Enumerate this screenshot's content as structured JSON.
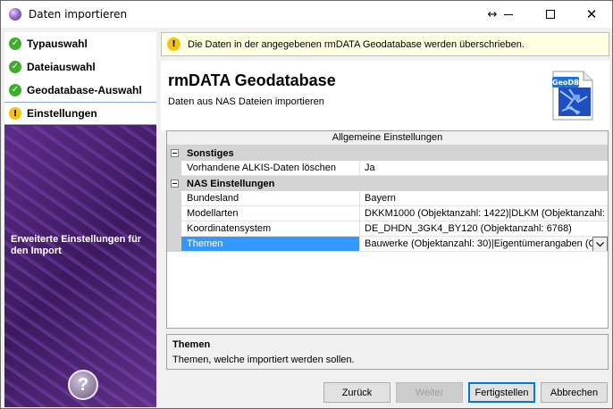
{
  "window": {
    "title": "Daten importieren",
    "controls": {
      "resize": "↔",
      "minimize": "—",
      "close": "✕"
    }
  },
  "steps": [
    {
      "label": "Typauswahl",
      "status": "done",
      "icon": "check-icon"
    },
    {
      "label": "Dateiauswahl",
      "status": "done",
      "icon": "check-icon"
    },
    {
      "label": "Geodatabase-Auswahl",
      "status": "done",
      "icon": "check-icon"
    },
    {
      "label": "Einstellungen",
      "status": "current",
      "icon": "warning-icon"
    }
  ],
  "left_panel": {
    "caption": "Erweiterte Einstellungen für den Import",
    "help_symbol": "?"
  },
  "banner": {
    "text": "Die Daten in der angegebenen rmDATA Geodatabase werden überschrieben.",
    "icon_symbol": "!"
  },
  "header": {
    "title": "rmDATA Geodatabase",
    "subtitle": "Daten aus NAS Dateien importieren",
    "icon_label": "GeoDB"
  },
  "grid": {
    "heading": "Allgemeine Einstellungen",
    "categories": [
      {
        "name": "Sonstiges",
        "rows": [
          {
            "name": "Vorhandene ALKIS-Daten löschen",
            "value": "Ja"
          }
        ]
      },
      {
        "name": "NAS Einstellungen",
        "rows": [
          {
            "name": "Bundesland",
            "value": "Bayern"
          },
          {
            "name": "Modellarten",
            "value": "DKKM1000 (Objektanzahl: 1422)|DLKM (Objektanzahl: ..."
          },
          {
            "name": "Koordinatensystem",
            "value": "DE_DHDN_3GK4_BY120 (Objektanzahl: 6768)"
          },
          {
            "name": "Themen",
            "value": "Bauwerke (Objektanzahl: 30)|Eigentümerangaben (Ob",
            "selected": true
          }
        ]
      }
    ]
  },
  "description": {
    "title": "Themen",
    "text": "Themen, welche importiert werden sollen."
  },
  "buttons": {
    "back": "Zurück",
    "next": "Weiter",
    "finish": "Fertigstellen",
    "cancel": "Abbrechen"
  },
  "colors": {
    "accent": "#0078d7",
    "selection": "#3399ff",
    "left_panel": "#4a2270",
    "banner_bg": "#ffffe1",
    "done": "#3cae2c",
    "warning": "#f4c414"
  }
}
